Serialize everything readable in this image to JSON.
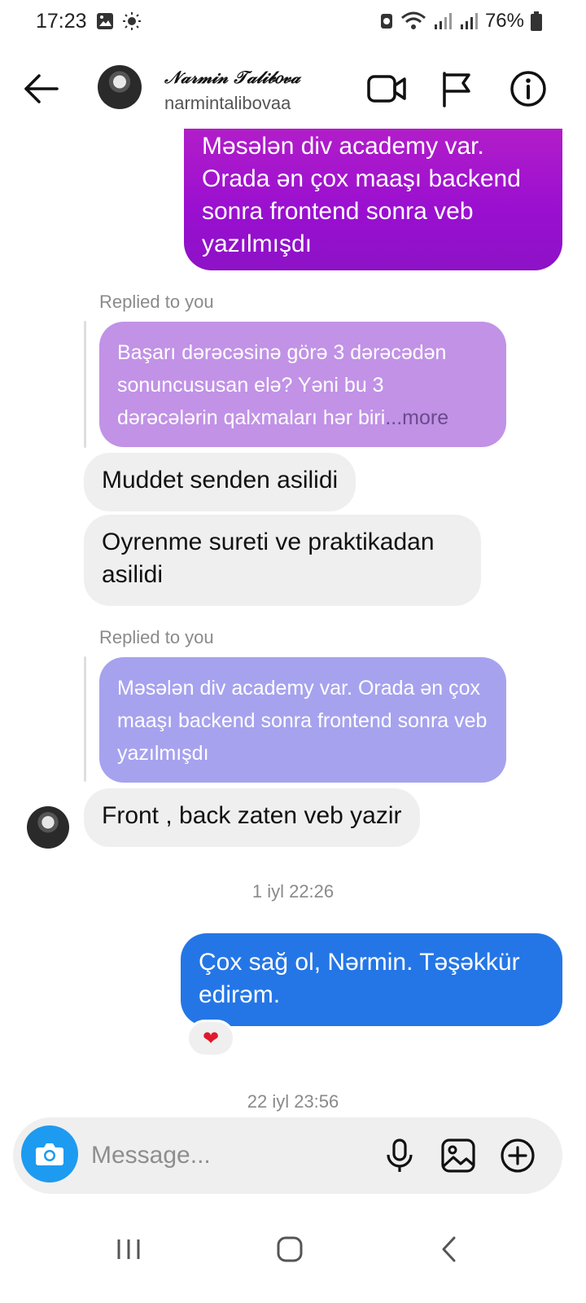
{
  "status_bar": {
    "time": "17:23",
    "battery": "76%"
  },
  "header": {
    "name": "𝒩𝒶𝓇𝓂𝒾𝓃 𝒯𝒶𝓁𝒾𝒷𝑜𝓋𝒶",
    "username": "narmintalibovaa"
  },
  "messages": {
    "sent_1": "Məsələn div academy var. Orada ən çox maaşı backend sonra frontend sonra veb yazılmışdı",
    "reply_1_label": "Replied to you",
    "reply_1_quote": "Başarı dərəcəsinə görə 3 dərəcədən sonuncususan elə? Yəni bu 3 dərəcələrin qalxmaları hər biri",
    "reply_1_more": "...more",
    "recv_1": "Muddet senden asilidi",
    "recv_2": "Oyrenme sureti ve praktikadan asilidi",
    "reply_2_label": "Replied to you",
    "reply_2_quote": "Məsələn div academy var. Orada ən çox maaşı backend sonra frontend sonra veb yazılmışdı",
    "recv_3": "Front , back zaten veb yazir",
    "timestamp_1": "1 iyl 22:26",
    "sent_2": "Çox sağ ol, Nərmin. Təşəkkür edirəm.",
    "reaction": "❤",
    "timestamp_2": "22 iyl 23:56"
  },
  "composer": {
    "placeholder": "Message..."
  },
  "colors": {
    "sent_purple": "#9a0fd0",
    "sent_blue": "#2476e6",
    "quote_1": "#c192e6",
    "quote_2": "#a6a2ee",
    "received": "#efefef",
    "camera": "#1d9bf0"
  }
}
